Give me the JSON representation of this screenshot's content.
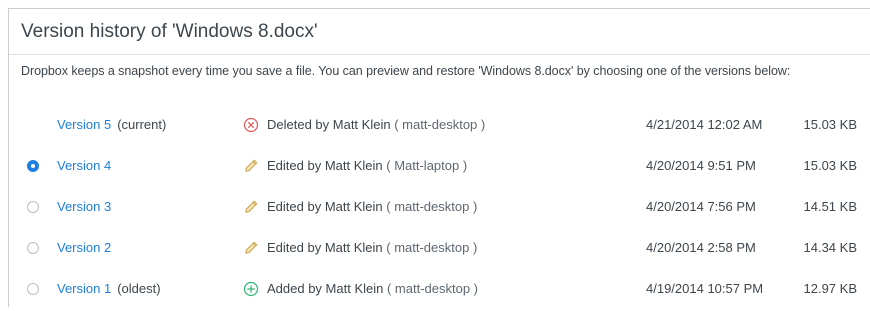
{
  "header": {
    "title": "Version history of 'Windows 8.docx'",
    "description": "Dropbox keeps a snapshot every time you save a file. You can preview and restore 'Windows 8.docx' by choosing one of the versions below:"
  },
  "colors": {
    "link": "#1f7fe0",
    "deleted_icon": "#e0575b",
    "edited_icon": "#c9a24a",
    "added_icon": "#2bb673"
  },
  "versions": [
    {
      "label": "Version 5",
      "tag": "(current)",
      "action_icon": "deleted-icon",
      "action": "Deleted by Matt Klein",
      "device": "( matt-desktop )",
      "date": "4/21/2014 12:02 AM",
      "size": "15.03 KB",
      "selected": false,
      "has_radio": false
    },
    {
      "label": "Version 4",
      "tag": "",
      "action_icon": "pencil-icon",
      "action": "Edited by Matt Klein",
      "device": "( Matt-laptop )",
      "date": "4/20/2014 9:51 PM",
      "size": "15.03 KB",
      "selected": true,
      "has_radio": true
    },
    {
      "label": "Version 3",
      "tag": "",
      "action_icon": "pencil-icon",
      "action": "Edited by Matt Klein",
      "device": "( matt-desktop )",
      "date": "4/20/2014 7:56 PM",
      "size": "14.51 KB",
      "selected": false,
      "has_radio": true
    },
    {
      "label": "Version 2",
      "tag": "",
      "action_icon": "pencil-icon",
      "action": "Edited by Matt Klein",
      "device": "( matt-desktop )",
      "date": "4/20/2014 2:58 PM",
      "size": "14.34 KB",
      "selected": false,
      "has_radio": true
    },
    {
      "label": "Version 1",
      "tag": "(oldest)",
      "action_icon": "added-icon",
      "action": "Added by Matt Klein",
      "device": "( matt-desktop )",
      "date": "4/19/2014 10:57 PM",
      "size": "12.97 KB",
      "selected": false,
      "has_radio": true
    }
  ]
}
